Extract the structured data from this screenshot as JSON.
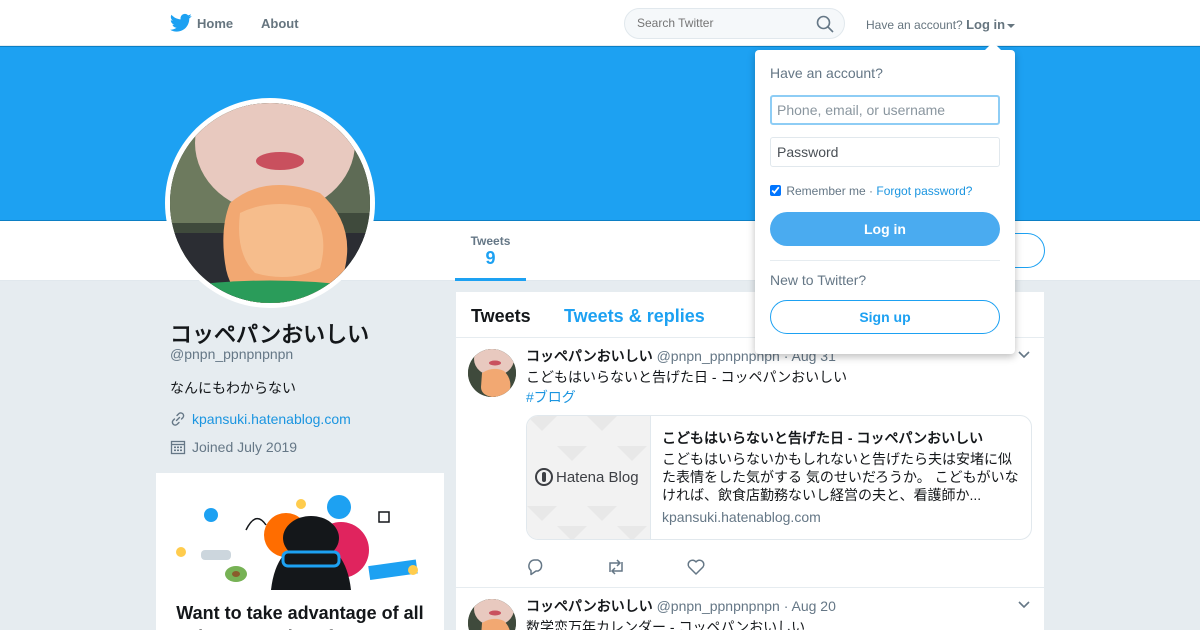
{
  "nav": {
    "home_label": "Home",
    "about_label": "About",
    "search_placeholder": "Search Twitter",
    "have_account": "Have an account?",
    "login_label": "Log in"
  },
  "colors": {
    "accent": "#1da1f2",
    "banner": "#1da1f2",
    "link": "#1b95e0"
  },
  "profile": {
    "name": "コッペパンおいしい",
    "handle": "@pnpn_ppnpnpnpn",
    "bio": "なんにもわからない",
    "link": "kpansuki.hatenablog.com",
    "joined": "Joined July 2019"
  },
  "stats": {
    "tweets_label": "Tweets",
    "tweets_value": "9"
  },
  "promo": {
    "title": "Want to take advantage of all the new Twitter features?"
  },
  "timeline": {
    "tabs": [
      "Tweets",
      "Tweets & replies"
    ],
    "tweets": [
      {
        "name": "コッペパンおいしい",
        "handle": "@pnpn_ppnpnpnpn",
        "date": "· Aug 31",
        "text": "こどもはいらないと告げた日 - コッペパンおいしい",
        "hashtag": "#ブログ",
        "card": {
          "logo_text": "Hatena Blog",
          "title": "こどもはいらないと告げた日 - コッペパンおいしい",
          "description": "こどもはいらないかもしれないと告げたら夫は安堵に似た表情をした気がする 気のせいだろうか。 こどもがいなければ、飲食店勤務ないし経営の夫と、看護師か...",
          "domain": "kpansuki.hatenablog.com"
        }
      },
      {
        "name": "コッペパンおいしい",
        "handle": "@pnpn_ppnpnpnpn",
        "date": "· Aug 20",
        "text": "数学恋万年カレンダー - コッペパンおいしい"
      }
    ]
  },
  "login_dropdown": {
    "heading": "Have an account?",
    "username_placeholder": "Phone, email, or username",
    "password_placeholder": "Password",
    "remember_label": "Remember me ·",
    "forgot_label": "Forgot password?",
    "login_button": "Log in",
    "new_to_twitter": "New to Twitter?",
    "signup_button": "Sign up"
  }
}
